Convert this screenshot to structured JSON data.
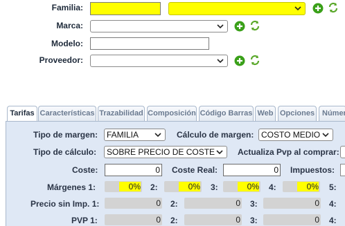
{
  "form": {
    "familia_label": "Familia:",
    "marca_label": "Marca:",
    "modelo_label": "Modelo:",
    "proveedor_label": "Proveedor:"
  },
  "tabs": [
    {
      "label": "Tarifas"
    },
    {
      "label": "Características"
    },
    {
      "label": "Trazabilidad"
    },
    {
      "label": "Composición"
    },
    {
      "label": "Código Barras"
    },
    {
      "label": "Web"
    },
    {
      "label": "Opciones"
    },
    {
      "label": "Númer"
    }
  ],
  "tarifas": {
    "tipo_margen_label": "Tipo de margen:",
    "tipo_margen_value": "FAMILIA",
    "calculo_margen_label": "Cálculo de margen:",
    "calculo_margen_value": "COSTO MEDIO",
    "tipo_calculo_label": "Tipo de cálculo:",
    "tipo_calculo_value": "SOBRE PRECIO DE COSTE",
    "actualiza_label": "Actualiza Pvp al comprar:",
    "coste_label": "Coste:",
    "coste_value": "0",
    "coste_real_label": "Coste Real:",
    "coste_real_value": "0",
    "impuestos_label": "Impuestos:",
    "margenes_label": "Márgenes 1:",
    "margenes": [
      "0%",
      "0%",
      "0%",
      "0%"
    ],
    "precio_sin_imp_label": "Precio sin Imp. 1:",
    "precio_sin_imp": [
      "0",
      "0",
      "0",
      "0"
    ],
    "pvp_label": "PVP 1:",
    "pvp": [
      "0",
      "0",
      "0",
      "0"
    ],
    "idx2": "2:",
    "idx3": "3:",
    "idx4": "4:",
    "idx5": "5:"
  },
  "colors": {
    "highlight": "#ffff00",
    "add_icon": "#3aa019",
    "refresh_icon": "#5aa82a",
    "panel_bg": "#dfe8f5"
  }
}
